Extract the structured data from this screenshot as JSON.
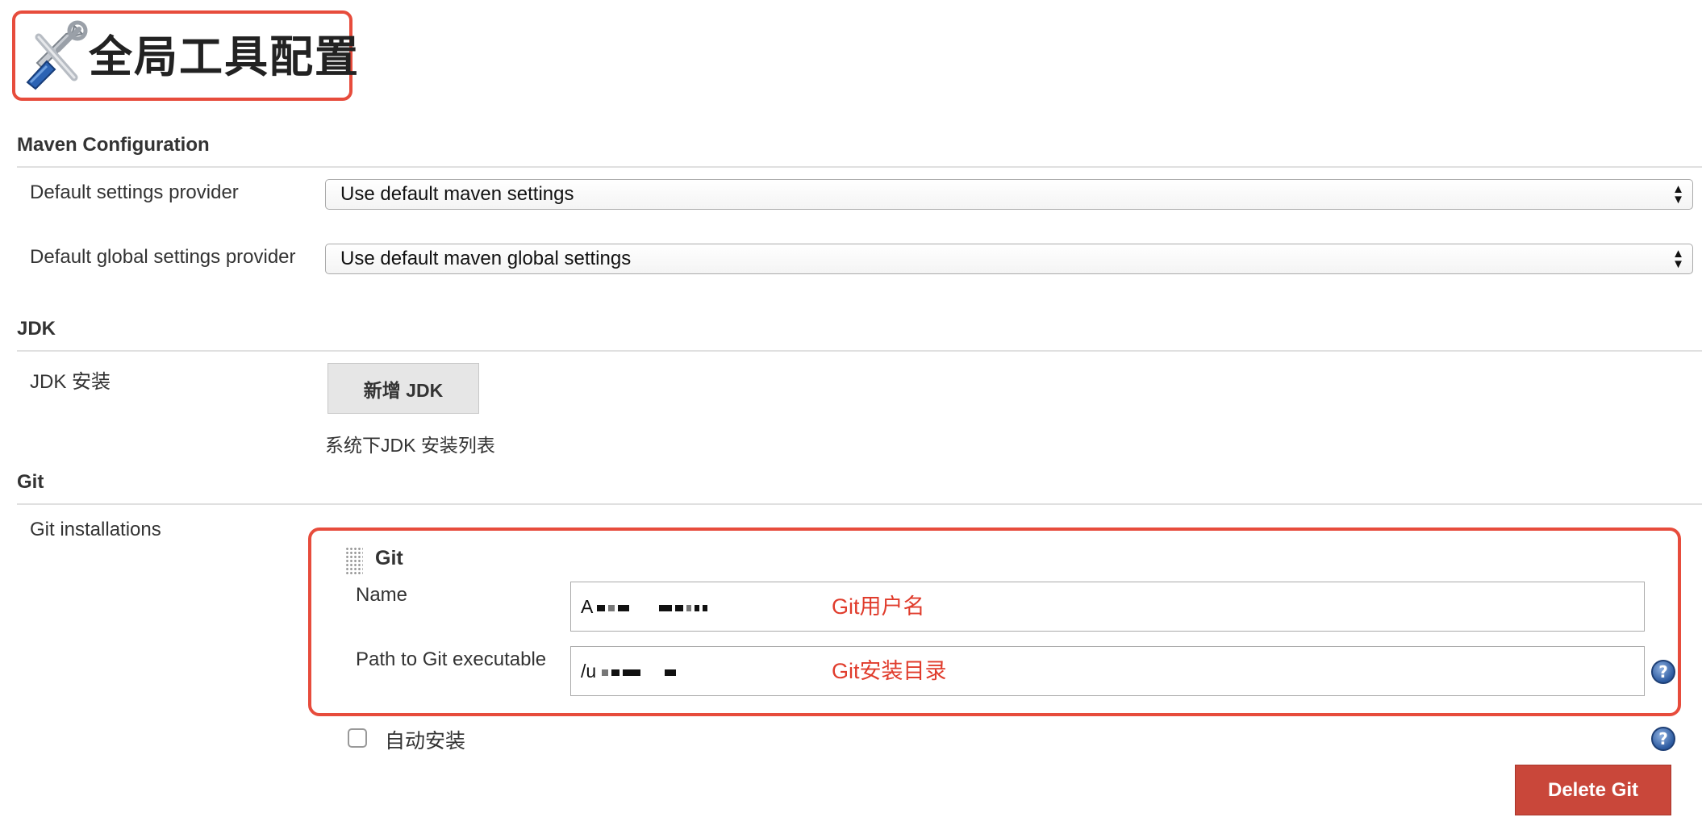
{
  "page": {
    "title": "全局工具配置",
    "icon": "tools-icon"
  },
  "maven": {
    "header": "Maven Configuration",
    "default_settings_label": "Default settings provider",
    "default_settings_value": "Use default maven settings",
    "global_settings_label": "Default global settings provider",
    "global_settings_value": "Use default maven global settings"
  },
  "jdk": {
    "header": "JDK",
    "install_label": "JDK 安装",
    "add_button": "新增 JDK",
    "description": "系统下JDK 安装列表"
  },
  "git": {
    "header": "Git",
    "installations_label": "Git installations",
    "block_title": "Git",
    "name_label": "Name",
    "name_value_prefix": "A",
    "name_annotation": "Git用户名",
    "path_label": "Path to Git executable",
    "path_value_prefix": "/u",
    "path_annotation": "Git安装目录",
    "auto_install_label": "自动安装",
    "auto_install_checked": false,
    "delete_button": "Delete Git"
  },
  "colors": {
    "highlight_border": "#e74c3c",
    "annotation_text": "#e03c2c",
    "delete_button": "#c9473a"
  }
}
